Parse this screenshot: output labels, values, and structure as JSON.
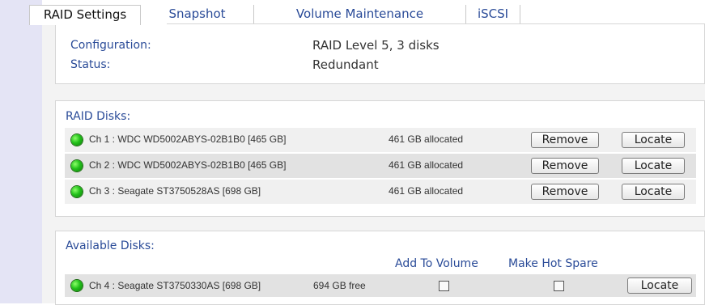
{
  "tabs": [
    {
      "label": "RAID Settings",
      "active": true
    },
    {
      "label": "Snapshot",
      "active": false
    },
    {
      "label": "Volume Maintenance",
      "active": false
    },
    {
      "label": "iSCSI",
      "active": false
    }
  ],
  "summary": {
    "configuration_label": "Configuration:",
    "configuration_value": "RAID Level 5, 3 disks",
    "status_label": "Status:",
    "status_value": "Redundant"
  },
  "raid_disks": {
    "title": "RAID Disks:",
    "rows": [
      {
        "name": "Ch 1 : WDC WD5002ABYS-02B1B0 [465 GB]",
        "allocation": "461 GB allocated",
        "remove_label": "Remove",
        "locate_label": "Locate",
        "status_color": "#22c11a"
      },
      {
        "name": "Ch 2 : WDC WD5002ABYS-02B1B0 [465 GB]",
        "allocation": "461 GB allocated",
        "remove_label": "Remove",
        "locate_label": "Locate",
        "status_color": "#22c11a"
      },
      {
        "name": "Ch 3 : Seagate ST3750528AS [698 GB]",
        "allocation": "461 GB allocated",
        "remove_label": "Remove",
        "locate_label": "Locate",
        "status_color": "#22c11a"
      }
    ]
  },
  "available_disks": {
    "title": "Available Disks:",
    "col_add": "Add To Volume",
    "col_hot_spare": "Make Hot Spare",
    "rows": [
      {
        "name": "Ch 4 : Seagate ST3750330AS [698 GB]",
        "free": "694 GB free",
        "add_to_volume": false,
        "hot_spare": false,
        "locate_label": "Locate",
        "status_color": "#22c11a"
      }
    ]
  },
  "colors": {
    "label_blue": "#2a4b98",
    "left_strip": "#e4e4f5",
    "status_green": "#22c11a"
  }
}
